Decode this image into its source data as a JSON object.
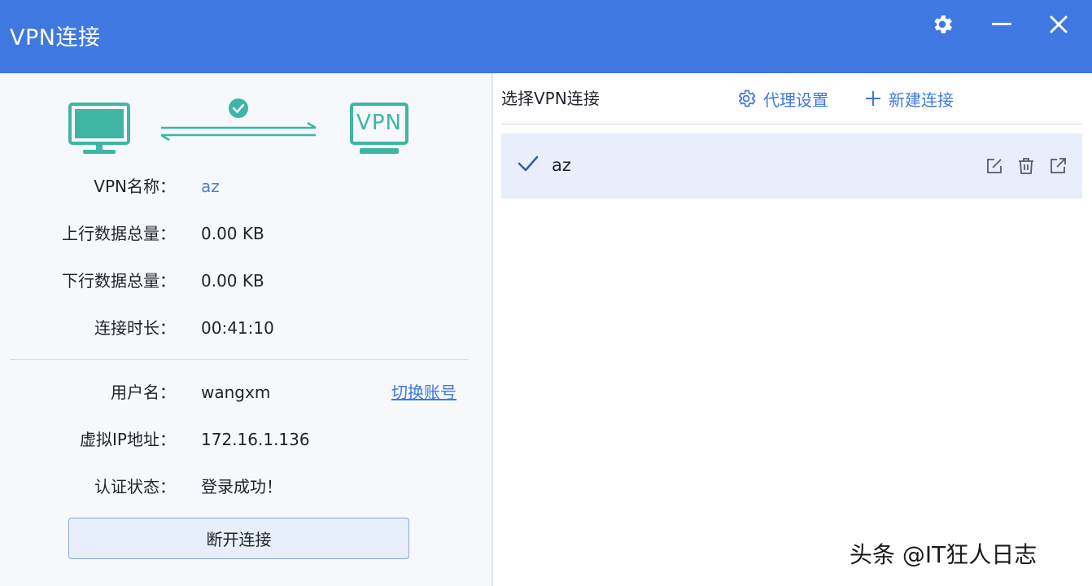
{
  "window": {
    "title": "VPN连接"
  },
  "titlebar_icons": [
    "gear-icon",
    "minimize-icon",
    "close-icon"
  ],
  "illustration": {
    "vpn_badge": "VPN"
  },
  "status": {
    "vpn_name_label": "VPN名称：",
    "vpn_name_value": "az",
    "upload_label": "上行数据总量：",
    "upload_value": "0.00 KB",
    "download_label": "下行数据总量：",
    "download_value": "0.00 KB",
    "duration_label": "连接时长：",
    "duration_value": "00:41:10"
  },
  "account": {
    "username_label": "用户名：",
    "username_value": "wangxm",
    "switch_account": "切换账号",
    "ip_label": "虚拟IP地址：",
    "ip_value": "172.16.1.136",
    "auth_label": "认证状态：",
    "auth_value": "登录成功！"
  },
  "disconnect_label": "断开连接",
  "right_panel": {
    "title": "选择VPN连接",
    "proxy_settings": "代理设置",
    "new_connection": "新建连接",
    "connections": [
      {
        "name": "az",
        "selected": true
      }
    ]
  },
  "watermark": "头条 @IT狂人日志",
  "colors": {
    "titlebar": "#3f78e0",
    "accent": "#3f78e0",
    "teal": "#3fb5a6",
    "selected_row": "#e8effa"
  }
}
